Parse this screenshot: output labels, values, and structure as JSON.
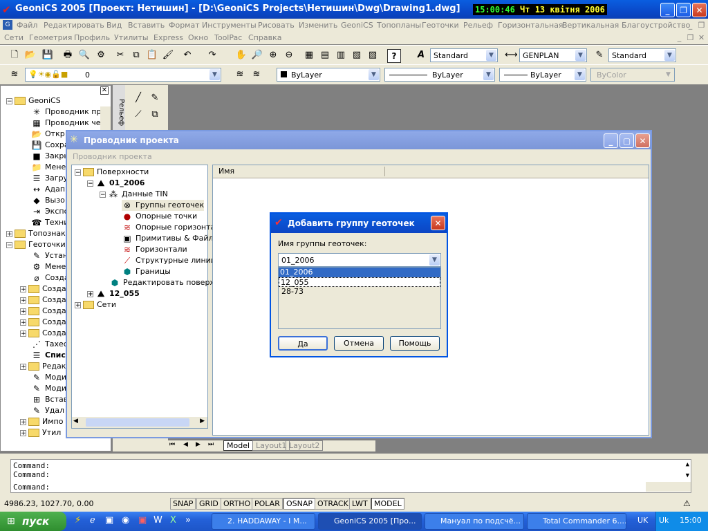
{
  "titlebar": {
    "title": "GeoniCS 2005 [Проект: Нетишин] - [D:\\GeoniCS Projects\\Нетишин\\Dwg\\Drawing1.dwg]",
    "clock_time": "15:00:46",
    "clock_date": "Чт 13 квітня 2006"
  },
  "menu1": [
    "Файл",
    "Редактировать",
    "Вид",
    "Вставить",
    "Формат",
    "Инструменты",
    "Рисовать",
    "Изменить",
    "GeoniCS",
    "Топопланы",
    "Геоточки",
    "Рельеф",
    "Горизонтальная",
    "Вертикальная",
    "Благоустройство"
  ],
  "menu2": [
    "Сети",
    "Геометрия",
    "Профиль",
    "Утилиты",
    "Express",
    "Окно",
    "ToolPac",
    "Справка"
  ],
  "toolbar": {
    "textstyle": "Standard",
    "dimstyle": "GENPLAN",
    "tablestyle": "Standard",
    "layer": "0",
    "color": "ByLayer",
    "linetype": "ByLayer",
    "lineweight": "ByLayer",
    "plotstyle": "ByColor"
  },
  "lefttree": {
    "root": "GeoniCS",
    "items": [
      "Проводник про",
      "Проводник черт",
      "Откр",
      "Сохра",
      "Закры",
      "Менед",
      "Загру",
      "Адап",
      "Вызо",
      "Экспо",
      "Техни"
    ],
    "topo": "Топознак",
    "geopoints": "Геоточки",
    "geo_items": [
      "Устан",
      "Менед",
      "Созда",
      "Созда",
      "Созда",
      "Созда",
      "Созда",
      "Созда",
      "Тахес",
      "Спис",
      "Редак",
      "Моди",
      "Моди",
      "Встав",
      "Удал",
      "Импо",
      "Утил"
    ]
  },
  "sidestrip_label": "Рельеф",
  "explorer": {
    "title": "Проводник проекта",
    "menu": "Проводник проекта",
    "column_name": "Имя",
    "tree": {
      "surfaces": "Поверхности",
      "s1": "01_2006",
      "tin": "Данные TIN",
      "tin_items": [
        "Группы геоточек",
        "Опорные точки",
        "Опорные горизонта",
        "Примитивы & Файлы",
        "Горизонтали",
        "Структурные линии",
        "Границы"
      ],
      "edit": "Редактировать поверхн",
      "s2": "12_055",
      "nets": "Сети"
    }
  },
  "dialog": {
    "title": "Добавить группу геоточек",
    "label": "Имя группы геоточек:",
    "value": "01_2006",
    "options": [
      "01_2006",
      "12_055",
      "28-73"
    ],
    "ok": "Да",
    "cancel": "Отмена",
    "help": "Помощь"
  },
  "tabs": [
    "Model",
    "Layout1",
    "Layout2"
  ],
  "command_lines": [
    "Command:",
    "Command:",
    "Command:"
  ],
  "status": {
    "coords": "4986.23, 1027.70, 0.00",
    "buttons": [
      "SNAP",
      "GRID",
      "ORTHO",
      "POLAR",
      "OSNAP",
      "OTRACK",
      "LWT",
      "MODEL"
    ]
  },
  "taskbar": {
    "start": "пуск",
    "tasks": [
      "2. HADDAWAY - I M...",
      "GeoniCS 2005 [Про...",
      "Мануал по подсчё...",
      "Total Commander 6...."
    ],
    "lang1": "UK",
    "lang2": "Uk",
    "time": "15:00"
  }
}
